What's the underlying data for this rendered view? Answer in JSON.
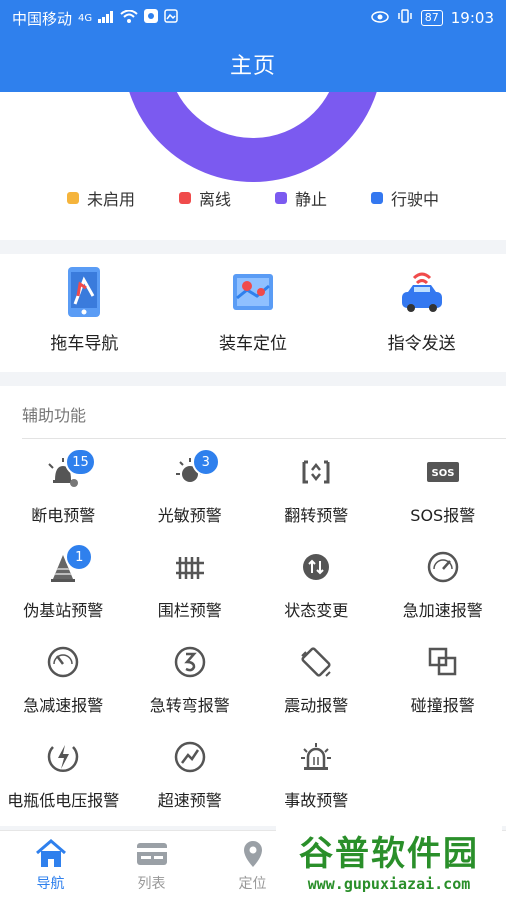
{
  "status_bar": {
    "carrier": "中国移动",
    "network": "4G",
    "battery": "87",
    "time": "19:03"
  },
  "header": {
    "title": "主页"
  },
  "legend": [
    {
      "label": "未启用",
      "color": "#f5b43c"
    },
    {
      "label": "离线",
      "color": "#f04b4b"
    },
    {
      "label": "静止",
      "color": "#7b5af0"
    },
    {
      "label": "行驶中",
      "color": "#3478f0"
    }
  ],
  "quick_actions": [
    {
      "label": "拖车导航",
      "icon": "phone-map-icon"
    },
    {
      "label": "装车定位",
      "icon": "map-location-icon"
    },
    {
      "label": "指令发送",
      "icon": "car-signal-icon"
    }
  ],
  "aux": {
    "title": "辅助功能",
    "items": [
      {
        "label": "断电预警",
        "icon": "power-off-icon",
        "badge": "15"
      },
      {
        "label": "光敏预警",
        "icon": "light-sensor-icon",
        "badge": "3"
      },
      {
        "label": "翻转预警",
        "icon": "flip-icon",
        "badge": ""
      },
      {
        "label": "SOS报警",
        "icon": "sos-icon",
        "badge": ""
      },
      {
        "label": "伪基站预警",
        "icon": "fake-station-icon",
        "badge": "1"
      },
      {
        "label": "围栏预警",
        "icon": "fence-icon",
        "badge": ""
      },
      {
        "label": "状态变更",
        "icon": "state-change-icon",
        "badge": ""
      },
      {
        "label": "急加速报警",
        "icon": "speed-up-icon",
        "badge": ""
      },
      {
        "label": "急减速报警",
        "icon": "speed-down-icon",
        "badge": ""
      },
      {
        "label": "急转弯报警",
        "icon": "sharp-turn-icon",
        "badge": ""
      },
      {
        "label": "震动报警",
        "icon": "vibration-icon",
        "badge": ""
      },
      {
        "label": "碰撞报警",
        "icon": "collision-icon",
        "badge": ""
      },
      {
        "label": "电瓶低电压报警",
        "icon": "low-voltage-icon",
        "badge": ""
      },
      {
        "label": "超速预警",
        "icon": "overspeed-icon",
        "badge": ""
      },
      {
        "label": "事故预警",
        "icon": "accident-icon",
        "badge": ""
      }
    ]
  },
  "tabs": [
    {
      "label": "导航",
      "active": true
    },
    {
      "label": "列表",
      "active": false
    },
    {
      "label": "定位",
      "active": false
    }
  ],
  "watermark": {
    "logo": "谷普软件园",
    "url": "www.gupuxiazai.com"
  }
}
